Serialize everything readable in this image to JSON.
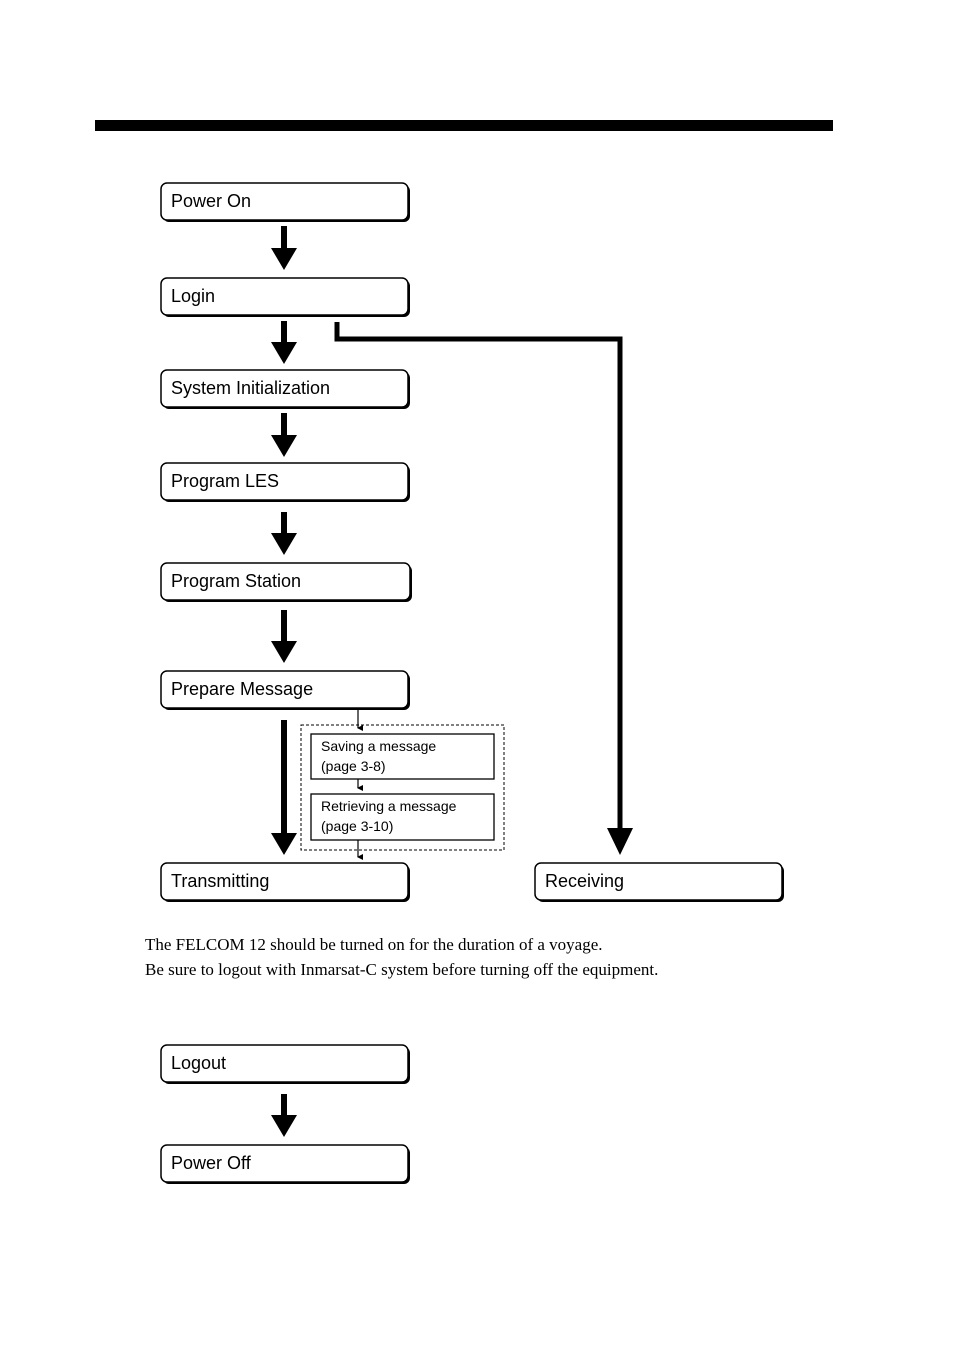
{
  "steps": {
    "power_on": "Power On",
    "login": "Login",
    "system_init": "System Initialization",
    "program_les": "Program LES",
    "program_station": "Program Station",
    "prepare_message": "Prepare Message",
    "transmitting": "Transmitting",
    "receiving": "Receiving",
    "logout": "Logout",
    "power_off": "Power Off"
  },
  "substeps": {
    "saving_line1": "Saving a message",
    "saving_line2": "(page 3-8)",
    "retrieving_line1": "Retrieving a message",
    "retrieving_line2": "(page 3-10)"
  },
  "notes": {
    "line1": "The FELCOM 12 should be turned on for the duration of a voyage.",
    "line2": "Be sure to logout with Inmarsat-C system before turning off the equipment."
  }
}
